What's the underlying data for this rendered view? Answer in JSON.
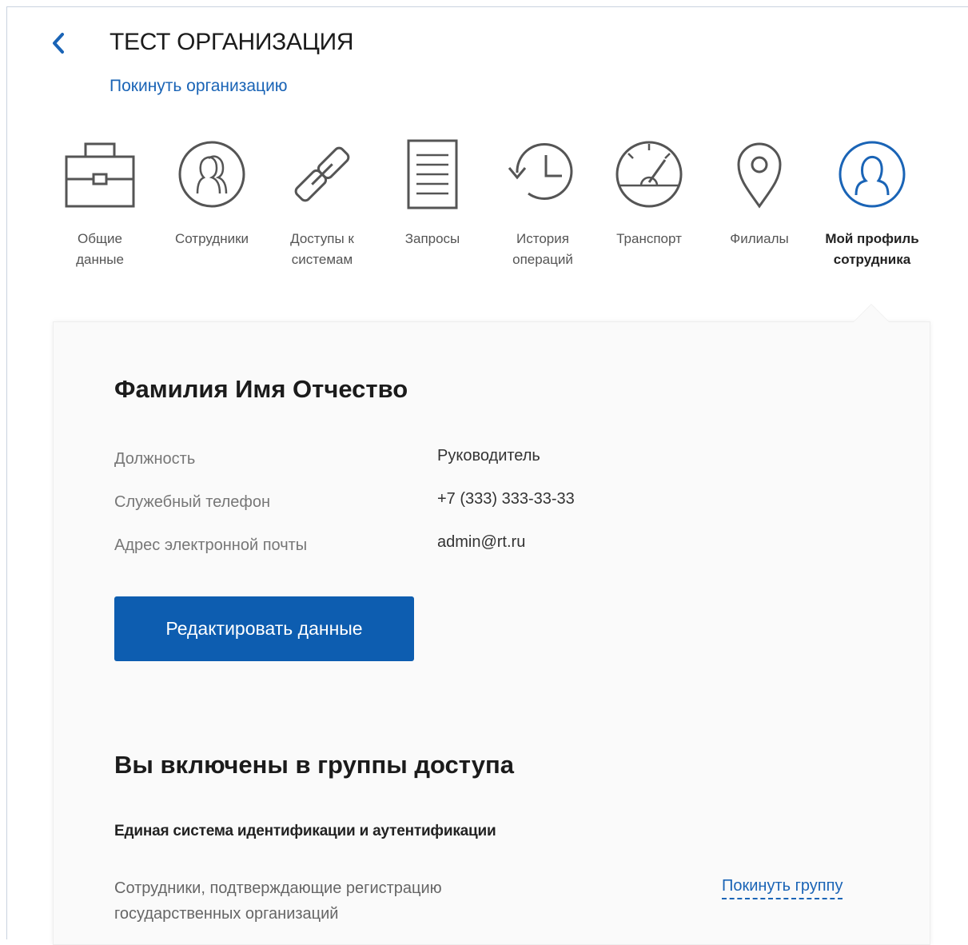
{
  "header": {
    "title": "ТЕСТ ОРГАНИЗАЦИЯ",
    "leave_org_link": "Покинуть организацию",
    "back_icon": "chevron-left-icon"
  },
  "nav": {
    "items": [
      {
        "label": "Общие\nданные",
        "icon": "briefcase-icon",
        "active": false
      },
      {
        "label": "Сотрудники",
        "icon": "employees-icon",
        "active": false
      },
      {
        "label": "Доступы к\nсистемам",
        "icon": "chain-link-icon",
        "active": false
      },
      {
        "label": "Запросы",
        "icon": "document-icon",
        "active": false
      },
      {
        "label": "История\nопераций",
        "icon": "history-icon",
        "active": false
      },
      {
        "label": "Транспорт",
        "icon": "speedometer-icon",
        "active": false
      },
      {
        "label": "Филиалы",
        "icon": "map-pin-icon",
        "active": false
      },
      {
        "label": "Мой профиль\nсотрудника",
        "icon": "profile-icon",
        "active": true
      }
    ]
  },
  "profile": {
    "full_name": "Фамилия Имя Отчество",
    "fields": [
      {
        "label": "Должность",
        "value": "Руководитель"
      },
      {
        "label": "Служебный телефон",
        "value": "+7 (333) 333-33-33"
      },
      {
        "label": "Адрес электронной почты",
        "value": "admin@rt.ru"
      }
    ],
    "edit_button": "Редактировать данные"
  },
  "groups": {
    "title": "Вы включены в группы доступа",
    "system_name": "Единая система идентификации и аутентификации",
    "group_name": "Сотрудники, подтверждающие регистрацию государственных организаций",
    "leave_group_link": "Покинуть группу"
  },
  "colors": {
    "accent": "#0d5db0",
    "link": "#1a64b6",
    "icon_inactive": "#555555",
    "icon_active": "#1a64b6"
  }
}
